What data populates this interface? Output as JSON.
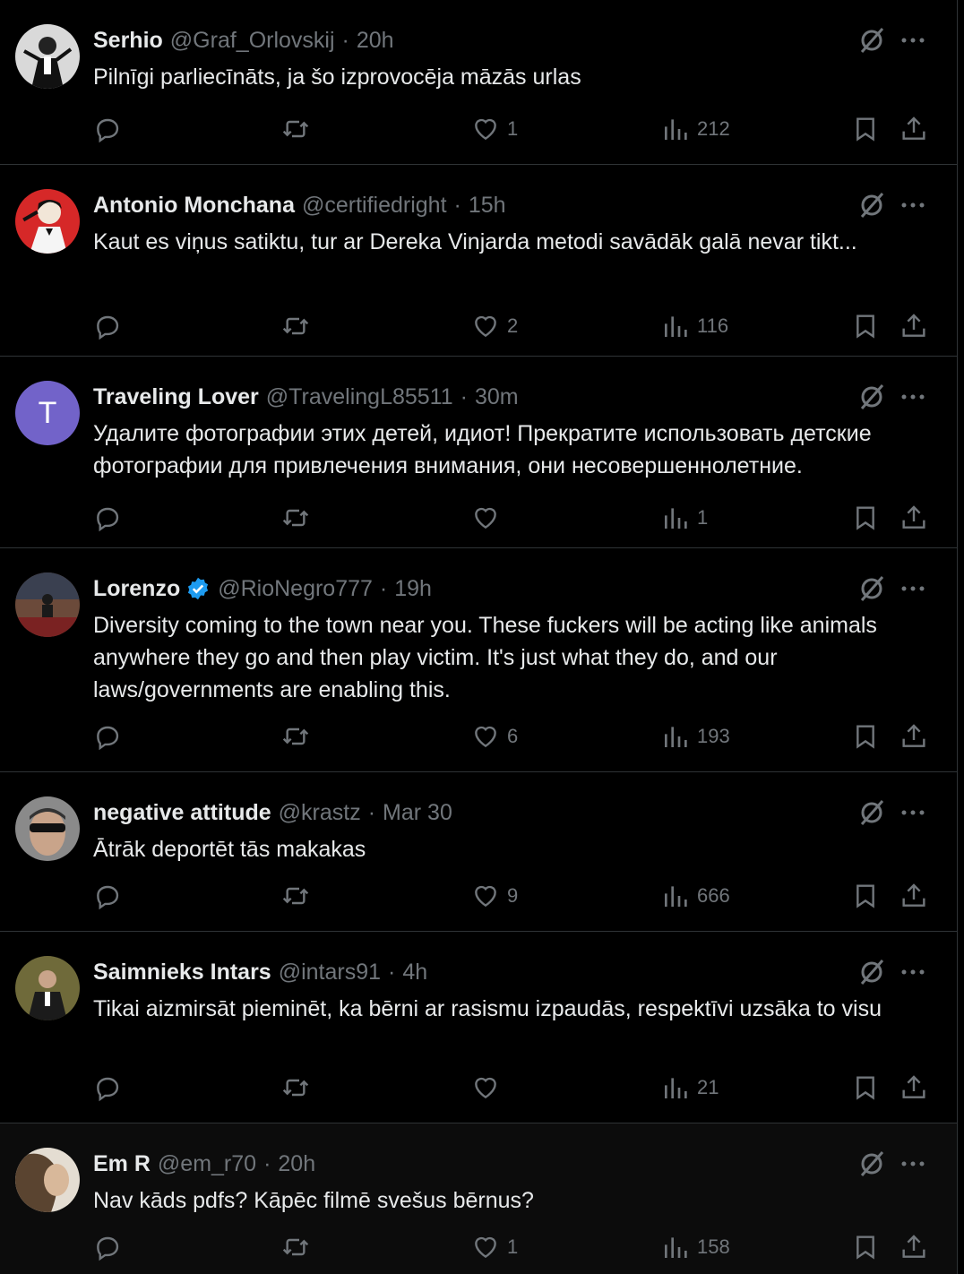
{
  "tweets": [
    {
      "name": "Serhio",
      "handle": "@Graf_Orlovskij",
      "time": "20h",
      "text": "Pilnīgi parliecīnāts, ja šo izprovocēja māzās urlas",
      "replies": "",
      "reposts": "",
      "likes": "1",
      "views": "212"
    },
    {
      "name": "Antonio Monchana",
      "handle": "@certifiedright",
      "time": "15h",
      "text": "Kaut es viņus satiktu, tur ar Dereka Vinjarda metodi savādāk galā nevar tikt...",
      "replies": "",
      "reposts": "",
      "likes": "2",
      "views": "116"
    },
    {
      "name": "Traveling Lover",
      "handle": "@TravelingL85511",
      "time": "30m",
      "avatar_letter": "T",
      "text": "Удалите фотографии этих детей, идиот! Прекратите использовать детские фотографии для привлечения внимания, они несовершеннолетние.",
      "replies": "",
      "reposts": "",
      "likes": "",
      "views": "1"
    },
    {
      "name": "Lorenzo",
      "handle": "@RioNegro777",
      "time": "19h",
      "verified": true,
      "text": "Diversity coming to the town near you. These fuckers will be acting like animals anywhere they go and then play victim. It's just what they do, and our laws/governments are enabling this.",
      "replies": "",
      "reposts": "",
      "likes": "6",
      "views": "193"
    },
    {
      "name": "negative attitude",
      "handle": "@krastz",
      "time": "Mar 30",
      "text": "Ātrāk deportēt tās makakas",
      "replies": "",
      "reposts": "",
      "likes": "9",
      "views": "666"
    },
    {
      "name": "Saimnieks Intars",
      "handle": "@intars91",
      "time": "4h",
      "text": "Tikai aizmirsāt pieminēt, ka bērni ar rasismu izpaudās, respektīvi uzsāka to visu",
      "replies": "",
      "reposts": "",
      "likes": "",
      "views": "21"
    },
    {
      "name": "Em R",
      "handle": "@em_r70",
      "time": "20h",
      "text": "Nav kāds pdfs? Kāpēc filmē svešus bērnus?",
      "replies": "",
      "reposts": "",
      "likes": "1",
      "views": "158"
    }
  ],
  "icons": {
    "reply": "reply-icon",
    "repost": "repost-icon",
    "like": "heart-icon",
    "views": "views-icon",
    "bookmark": "bookmark-icon",
    "share": "share-icon",
    "grok": "grok-icon",
    "more": "more-icon",
    "verified": "verified-badge-icon"
  },
  "colors": {
    "background": "#000000",
    "text": "#e7e9ea",
    "muted": "#71767b",
    "divider": "#2f3336",
    "verified": "#1d9bf0",
    "avatar_letter_bg": "#7263c9"
  }
}
